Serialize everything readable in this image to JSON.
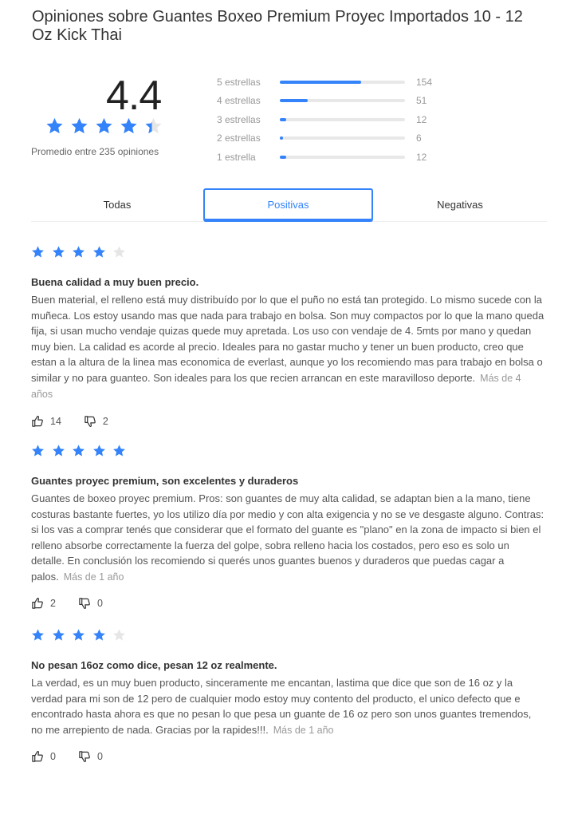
{
  "title": "Opiniones sobre Guantes Boxeo Premium Proyec Importados 10 - 12 Oz Kick Thai",
  "summary": {
    "average": "4.4",
    "rating_value": 4.4,
    "caption": "Promedio entre 235 opiniones"
  },
  "histogram": [
    {
      "label": "5 estrellas",
      "count": "154",
      "fraction": 0.65
    },
    {
      "label": "4 estrellas",
      "count": "51",
      "fraction": 0.22
    },
    {
      "label": "3 estrellas",
      "count": "12",
      "fraction": 0.05
    },
    {
      "label": "2 estrellas",
      "count": "6",
      "fraction": 0.025
    },
    {
      "label": "1 estrella",
      "count": "12",
      "fraction": 0.05
    }
  ],
  "tabs": {
    "all": "Todas",
    "positive": "Positivas",
    "negative": "Negativas",
    "selected": "positive"
  },
  "reviews": [
    {
      "rating": 4,
      "title": "Buena calidad a muy buen precio.",
      "body": "Buen material, el relleno está muy distribuído por lo que el puño no está tan protegido. Lo mismo sucede con la muñeca. Los estoy usando mas que nada para trabajo en bolsa. Son muy compactos por lo que la mano queda fija, si usan mucho vendaje quizas quede muy apretada. Los uso con vendaje de 4. 5mts por mano y quedan muy bien. La calidad es acorde al precio. Ideales para no gastar mucho y tener un buen producto, creo que estan a la altura de la linea mas economica de everlast, aunque yo los recomiendo mas para trabajo en bolsa o similar y no para guanteo. Son ideales para los que recien arrancan en este maravilloso deporte.",
      "date": "Más de 4 años",
      "likes": "14",
      "dislikes": "2"
    },
    {
      "rating": 5,
      "title": "Guantes proyec premium, son excelentes y duraderos",
      "body": "Guantes de boxeo proyec premium. Pros: son guantes de muy alta calidad, se adaptan bien a la mano, tiene costuras bastante fuertes, yo los utilizo día por medio y con alta exigencia y no se ve desgaste alguno. Contras: si los vas a comprar tenés que considerar que el formato del guante es \"plano\" en la zona de impacto si bien el relleno absorbe correctamente la fuerza del golpe, sobra relleno hacia los costados, pero eso es solo un detalle. En conclusión los recomiendo si querés unos guantes buenos y duraderos que puedas cagar a palos.",
      "date": "Más de 1 año",
      "likes": "2",
      "dislikes": "0"
    },
    {
      "rating": 4,
      "title": "No pesan 16oz como dice, pesan 12 oz realmente.",
      "body": "La verdad, es un muy buen producto, sinceramente me encantan, lastima que dice que son de 16 oz y la verdad para mi son de 12 pero de cualquier modo estoy muy contento del producto, el unico defecto que e encontrado hasta ahora es que no pesan lo que pesa un guante de 16 oz pero son unos guantes tremendos, no me arrepiento de nada. Gracias por la rapides!!!.",
      "date": "Más de 1 año",
      "likes": "0",
      "dislikes": "0"
    }
  ],
  "colors": {
    "accent": "#3483fa",
    "star_empty": "#e6e6e6",
    "text": "#333333",
    "muted": "#999999"
  },
  "icons": {
    "like": "thumbs-up-icon",
    "dislike": "thumbs-down-icon",
    "star": "star-icon"
  }
}
